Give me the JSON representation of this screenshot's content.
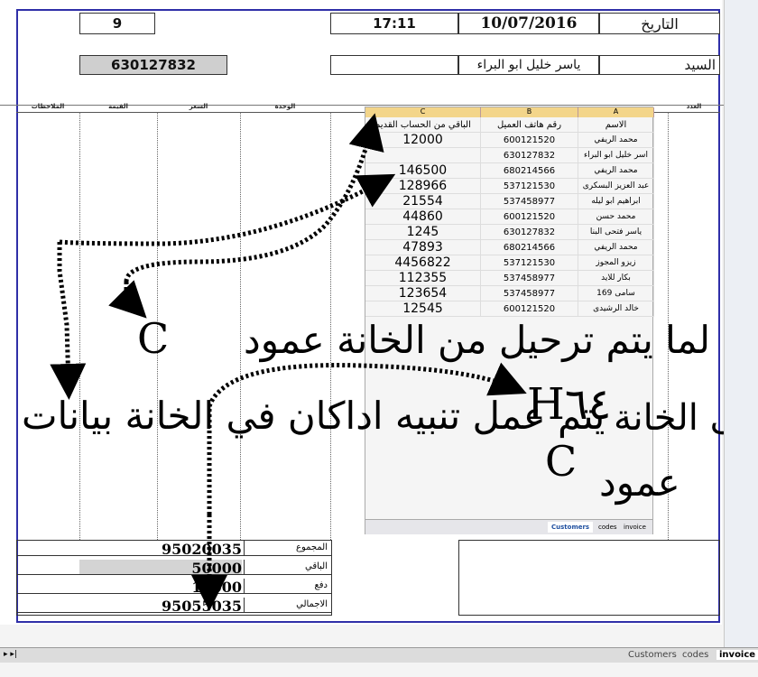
{
  "header": {
    "date_label": "التاريخ",
    "date_value": "10/07/2016",
    "time_value": "17:11",
    "invoice_number": "9",
    "customer_label": "السيد",
    "customer_name": "ياسر خليل ابو البراء",
    "phone_value": "630127832"
  },
  "columns": [
    "الملاحظات",
    "القيمة",
    "السعر",
    "الوحدة",
    "العدد"
  ],
  "excel_popup": {
    "col_letters": [
      "C",
      "B",
      "A"
    ],
    "headers": [
      "الباقي من الحساب القديم",
      "رقم هاتف العميل",
      "الاسم"
    ],
    "rows": [
      {
        "remain": "12000",
        "phone": "600121520",
        "name": "محمد الريفي"
      },
      {
        "remain": "",
        "phone": "630127832",
        "name": "اسر خليل ابو البراء"
      },
      {
        "remain": "146500",
        "phone": "680214566",
        "name": "محمد الريفي"
      },
      {
        "remain": "128966",
        "phone": "537121530",
        "name": "عبد العزيز البسكرى"
      },
      {
        "remain": "21554",
        "phone": "537458977",
        "name": "ابراهيم ابو ليله"
      },
      {
        "remain": "44860",
        "phone": "600121520",
        "name": "محمد حسن"
      },
      {
        "remain": "1245",
        "phone": "630127832",
        "name": "ياسر فتحى البنا"
      },
      {
        "remain": "47893",
        "phone": "680214566",
        "name": "محمد الريفي"
      },
      {
        "remain": "4456822",
        "phone": "537121530",
        "name": "زيزو المجوز"
      },
      {
        "remain": "112355",
        "phone": "537458977",
        "name": "بكار للايد"
      },
      {
        "remain": "123654",
        "phone": "537458977",
        "name": "سامى 169"
      },
      {
        "remain": "12545",
        "phone": "600121520",
        "name": "خالد الرشيدى"
      }
    ],
    "tabs": [
      "Customers",
      "codes",
      "invoice"
    ]
  },
  "totals": [
    {
      "label": "المجموع",
      "value": "95020035"
    },
    {
      "label": "الباقي",
      "value": "50000"
    },
    {
      "label": "دفع",
      "value": "15000"
    },
    {
      "label": "الاجمالي",
      "value": "95055035"
    }
  ],
  "annotation": {
    "line1": "اريد لما يتم ترحيل من الخانة عمود",
    "c_letter_left": "C",
    "line2": "الى الخانة",
    "h64": "H٦٤",
    "line2b": "يتم عمل تنبيه اداكان في الخانة بيانات",
    "c_letter_bottom": "C",
    "line3": "عمود"
  },
  "sheet_tabs": [
    "Customers",
    "codes",
    "invoice"
  ]
}
